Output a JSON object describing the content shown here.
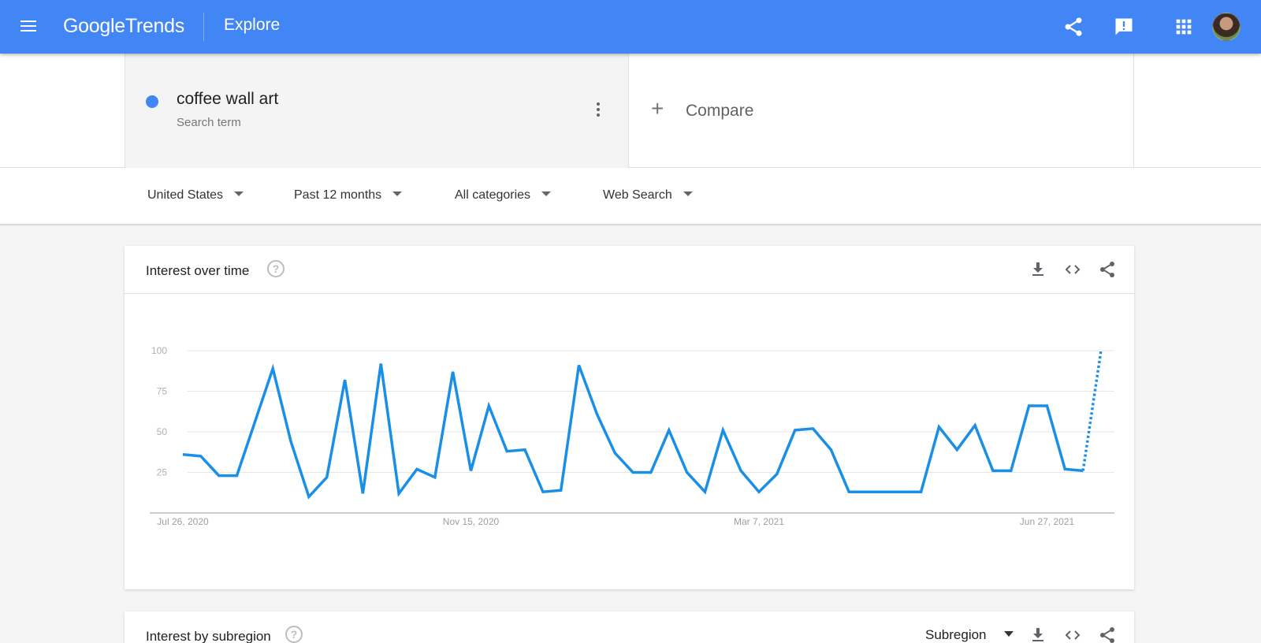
{
  "header": {
    "logo_google": "Google",
    "logo_trends": "Trends",
    "title": "Explore",
    "icons": [
      "menu-icon",
      "share-icon",
      "feedback-icon",
      "apps-icon",
      "avatar"
    ]
  },
  "search": {
    "term": "coffee wall art",
    "term_type": "Search term",
    "term_color": "#4285f4",
    "compare_label": "Compare"
  },
  "filters": {
    "location": "United States",
    "time_range": "Past 12 months",
    "category": "All categories",
    "property": "Web Search"
  },
  "interest_over_time": {
    "title": "Interest over time"
  },
  "interest_by_subregion": {
    "title": "Interest by subregion",
    "resolution": "Subregion"
  },
  "colors": {
    "appbar": "#4285f4",
    "series_line": "#1a8fe6",
    "background": "#f5f5f5"
  },
  "chart_data": {
    "type": "line",
    "title": "",
    "xlabel": "",
    "ylabel": "",
    "ylim": [
      0,
      100
    ],
    "y_ticks": [
      25,
      50,
      75,
      100
    ],
    "x_ticks": [
      "Jul 26, 2020",
      "Nov 15, 2020",
      "Mar 7, 2021",
      "Jun 27, 2021"
    ],
    "grid": true,
    "x": [
      "Jul 26, 2020",
      "Aug 2, 2020",
      "Aug 9, 2020",
      "Aug 16, 2020",
      "Aug 23, 2020",
      "Aug 30, 2020",
      "Sep 6, 2020",
      "Sep 13, 2020",
      "Sep 20, 2020",
      "Sep 27, 2020",
      "Oct 4, 2020",
      "Oct 11, 2020",
      "Oct 18, 2020",
      "Oct 25, 2020",
      "Nov 1, 2020",
      "Nov 8, 2020",
      "Nov 15, 2020",
      "Nov 22, 2020",
      "Nov 29, 2020",
      "Dec 6, 2020",
      "Dec 13, 2020",
      "Dec 20, 2020",
      "Dec 27, 2020",
      "Jan 3, 2021",
      "Jan 10, 2021",
      "Jan 17, 2021",
      "Jan 24, 2021",
      "Jan 31, 2021",
      "Feb 7, 2021",
      "Feb 14, 2021",
      "Feb 21, 2021",
      "Feb 28, 2021",
      "Mar 7, 2021",
      "Mar 14, 2021",
      "Mar 21, 2021",
      "Mar 28, 2021",
      "Apr 4, 2021",
      "Apr 11, 2021",
      "Apr 18, 2021",
      "Apr 25, 2021",
      "May 2, 2021",
      "May 9, 2021",
      "May 16, 2021",
      "May 23, 2021",
      "May 30, 2021",
      "Jun 6, 2021",
      "Jun 13, 2021",
      "Jun 20, 2021",
      "Jun 27, 2021",
      "Jul 4, 2021",
      "Jul 11, 2021",
      "Jul 18, 2021",
      "Jul 25, 2021"
    ],
    "series": [
      {
        "values": [
          36,
          35,
          23,
          23,
          56,
          89,
          44,
          10,
          22,
          82,
          12,
          92,
          12,
          27,
          22,
          87,
          26,
          66,
          38,
          39,
          13,
          14,
          91,
          61,
          37,
          25,
          25,
          51,
          25,
          13,
          51,
          26,
          13,
          24,
          51,
          52,
          39,
          13,
          13,
          13,
          13,
          13,
          53,
          39,
          54,
          26,
          26,
          66,
          66,
          27,
          26,
          100
        ],
        "partial_last_point": true
      }
    ]
  }
}
